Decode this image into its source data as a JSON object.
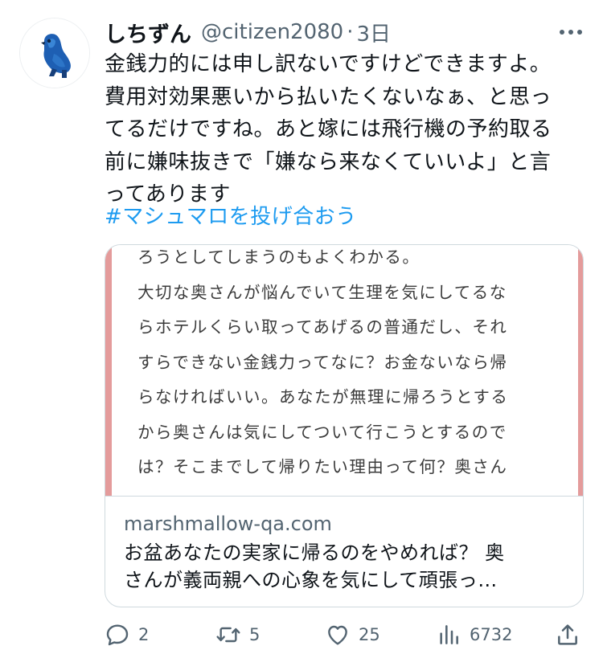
{
  "author": {
    "display_name": "しちずん",
    "handle": "@citizen2080",
    "separator": "·",
    "time": "3日"
  },
  "tweet": {
    "text": "金銭力的には申し訳ないですけどできますよ。\n費用対効果悪いから払いたくないなぁ、と思っ\nてるだけですね。あと嫁には飛行機の予約取る\n前に嫌味抜きで「嫌なら来なくていいよ」と言\nってあります",
    "hashtag": "#マシュマロを投げ合おう"
  },
  "card": {
    "image_text": "ろうとしてしまうのもよくわかる。\n大切な奥さんが悩んでいて生理を気にしてるな\nらホテルくらい取ってあげるの普通だし、それ\nすらできない金銭力ってなに？お金ないなら帰\nらなければいい。あなたが無理に帰ろうとする\nから奥さんは気にしてついて行こうとするので\nは？そこまでして帰りたい理由って何？奥さん",
    "domain": "marshmallow-qa.com",
    "title": "お盆あなたの実家に帰るのをやめれば？ 奥\nさんが義両親への心象を気にして頑張っ…"
  },
  "actions": {
    "reply_count": "2",
    "retweet_count": "5",
    "like_count": "25",
    "view_count": "6732"
  },
  "colors": {
    "accent": "#1d9bf0",
    "secondary_text": "#536471",
    "card_image_border": "#e49b9b"
  },
  "icons": {
    "avatar": "blue-bird-figure-avatar",
    "more": "more-horizontal-icon",
    "reply": "reply-icon",
    "retweet": "retweet-icon",
    "like": "heart-icon",
    "views": "views-chart-icon",
    "share": "share-icon"
  }
}
